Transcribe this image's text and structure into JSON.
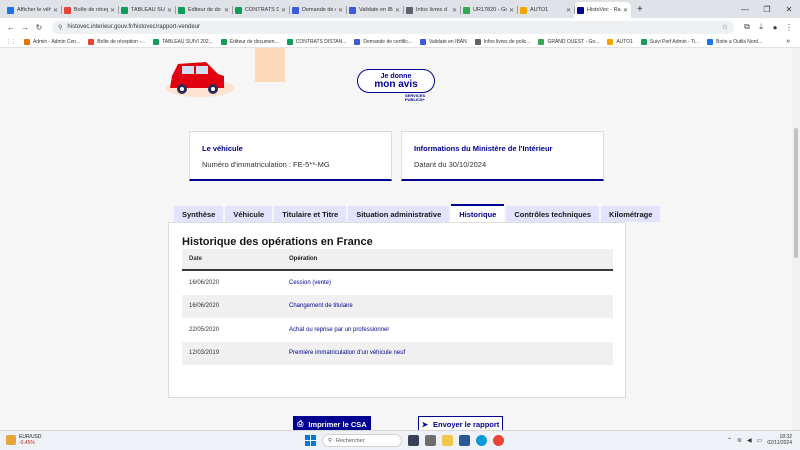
{
  "browser": {
    "tabs": [
      {
        "label": "Afficher le véh",
        "color": "#1a73e8"
      },
      {
        "label": "Boîte de récep",
        "color": "#ea4335"
      },
      {
        "label": "TABLEAU SUIVI",
        "color": "#0f9d58"
      },
      {
        "label": "Éditeur de do",
        "color": "#0f9d58"
      },
      {
        "label": "CONTRATS D'",
        "color": "#0f9d58"
      },
      {
        "label": "Demande de c",
        "color": "#3b5bdb"
      },
      {
        "label": "Validate en IBA",
        "color": "#3b5bdb"
      },
      {
        "label": "Infos livres d",
        "color": "#5f6368"
      },
      {
        "label": "UR17820 - Go",
        "color": "#34a853"
      },
      {
        "label": "AUTO1",
        "color": "#f4a300"
      },
      {
        "label": "HistoVec - Ra",
        "color": "#000091",
        "active": true
      }
    ],
    "url": "histovec.interieur.gouv.fr/histovec/rapport-vendeur",
    "bookmarks": [
      {
        "label": "Admin - Admin Cen...",
        "color": "#e8710a"
      },
      {
        "label": "Boîte de réception -...",
        "color": "#ea4335"
      },
      {
        "label": "TABLEAU SUIVI 202...",
        "color": "#0f9d58"
      },
      {
        "label": "Éditeur de documen...",
        "color": "#0f9d58"
      },
      {
        "label": "CONTRATS DISTAN...",
        "color": "#0f9d58"
      },
      {
        "label": "Demande de certific...",
        "color": "#3b5bdb"
      },
      {
        "label": "Validate en IBAN",
        "color": "#3b5bdb"
      },
      {
        "label": "Infos livres de polic...",
        "color": "#5f6368"
      },
      {
        "label": "GRAND OUEST - Go...",
        "color": "#34a853"
      },
      {
        "label": "AUTO1",
        "color": "#f4a300"
      },
      {
        "label": "Suivi Perf Admin - Ti...",
        "color": "#0f9d58"
      },
      {
        "label": "Boite a Outils Nord...",
        "color": "#1a73e8"
      }
    ]
  },
  "avis": {
    "line1": "Je donne",
    "line2": "mon avis",
    "logo1": "SERVICES",
    "logo2": "PUBLICS+"
  },
  "cards": {
    "vehicle": {
      "title": "Le véhicule",
      "value": "Numéro d'immatriculation : FE-5**-MG"
    },
    "ministry": {
      "title": "Informations du Ministère de l'Intérieur",
      "value": "Datant du 30/10/2024"
    }
  },
  "tabs": [
    {
      "label": "Synthèse"
    },
    {
      "label": "Véhicule"
    },
    {
      "label": "Titulaire et Titre"
    },
    {
      "label": "Situation administrative"
    },
    {
      "label": "Historique",
      "active": true
    },
    {
      "label": "Contrôles techniques"
    },
    {
      "label": "Kilométrage"
    }
  ],
  "history": {
    "title": "Historique des opérations en France",
    "headers": {
      "date": "Date",
      "operation": "Opération"
    },
    "rows": [
      {
        "date": "16/06/2020",
        "operation": "Cession (vente)"
      },
      {
        "date": "16/06/2020",
        "operation": "Changement de titulaire"
      },
      {
        "date": "22/05/2020",
        "operation": "Achat ou reprise par un professionnel"
      },
      {
        "date": "12/03/2019",
        "operation": "Première immatriculation d'un véhicule neuf"
      }
    ]
  },
  "actions": {
    "print": "Imprimer le CSA",
    "send": "Envoyer le rapport"
  },
  "taskbar": {
    "ticker": "EUR/USD",
    "ticker_change": "-0.45%",
    "search_placeholder": "Rechercher",
    "time": "18:32",
    "date": "02/11/2024"
  }
}
